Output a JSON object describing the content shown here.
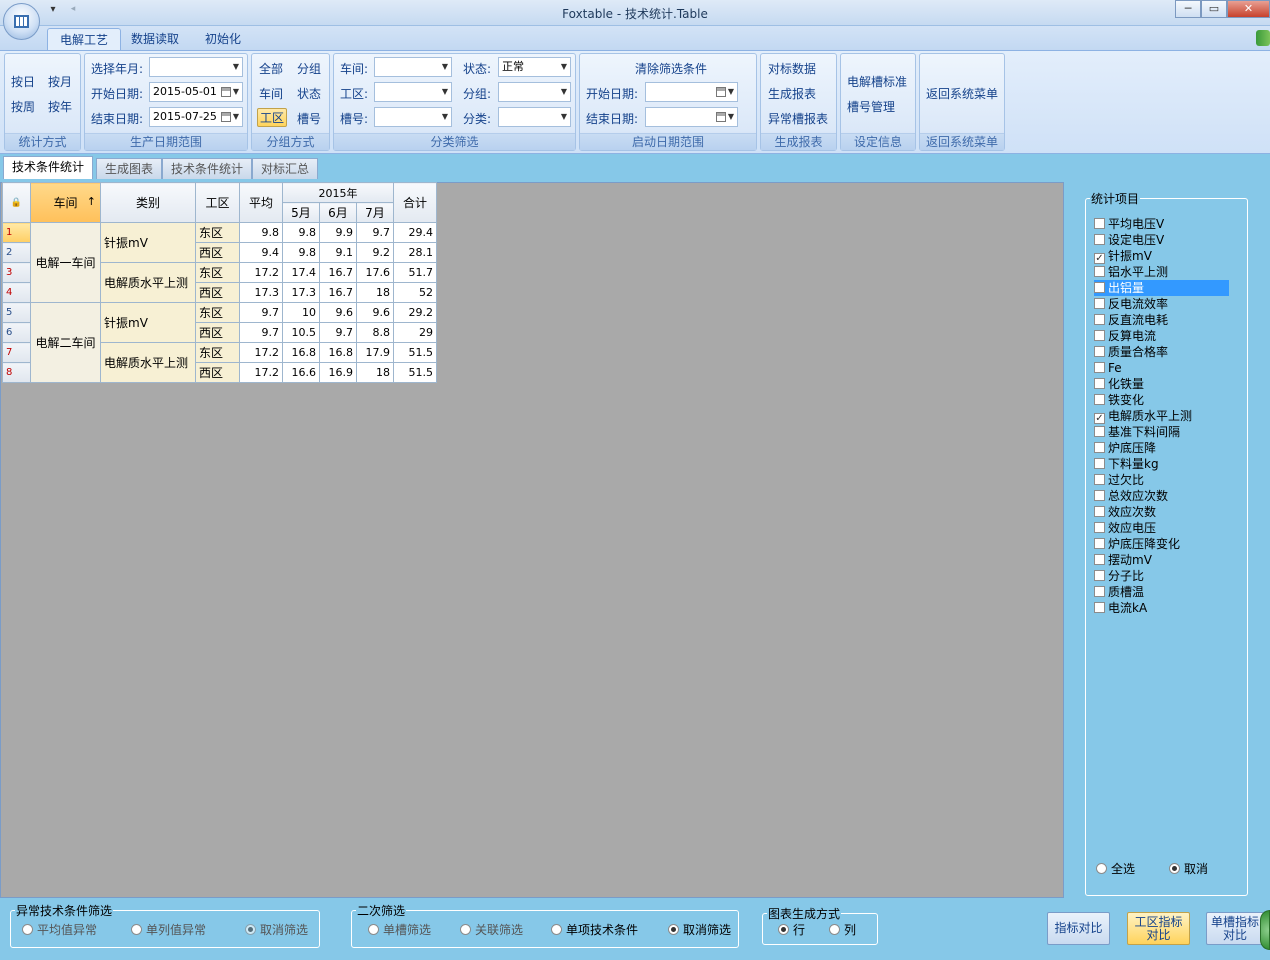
{
  "window": {
    "title": "Foxtable - 技术统计.Table"
  },
  "ribbon_tabs": [
    "电解工艺",
    "数据读取",
    "初始化"
  ],
  "groups": {
    "stat": {
      "label": "统计方式",
      "buttons": [
        "按日",
        "按月",
        "按周",
        "按年"
      ]
    },
    "range": {
      "label": "生产日期范围",
      "ym_label": "选择年月:",
      "ym_value": "",
      "start_label": "开始日期:",
      "start_value": "2015-05-01",
      "end_label": "结束日期:",
      "end_value": "2015-07-25"
    },
    "grouping": {
      "label": "分组方式",
      "buttons": [
        "全部",
        "分组",
        "车间",
        "状态",
        "工区",
        "槽号"
      ],
      "selected": "工区"
    },
    "filter": {
      "label": "分类筛选",
      "workshop_label": "车间:",
      "workshop_value": "",
      "area_label": "工区:",
      "area_value": "",
      "cell_label": "槽号:",
      "cell_value": "",
      "status_label": "状态:",
      "status_value": "正常",
      "group_label": "分组:",
      "group_value": "",
      "class_label": "分类:",
      "class_value": ""
    },
    "startdate": {
      "label": "启动日期范围",
      "clear": "清除筛选条件",
      "start_label": "开始日期:",
      "start_value": "",
      "end_label": "结束日期:",
      "end_value": ""
    },
    "report": {
      "label": "生成报表",
      "buttons": [
        "对标数据",
        "生成报表",
        "异常槽报表"
      ]
    },
    "settings": {
      "label": "设定信息",
      "buttons": [
        "电解槽标准",
        "槽号管理"
      ]
    },
    "back": {
      "label": "返回系统菜单",
      "button": "返回系统菜单"
    }
  },
  "doc_tabs": [
    "技术条件统计",
    "生成图表",
    "技术条件统计",
    "对标汇总"
  ],
  "table": {
    "headers": {
      "workshop": "车间",
      "sort_arrow": "↑",
      "category": "类别",
      "area": "工区",
      "avg": "平均",
      "year": "2015年",
      "months": [
        "5月",
        "6月",
        "7月"
      ],
      "total": "合计"
    },
    "rows": [
      {
        "idx": "1",
        "workshop": "电解一车间",
        "category": "针振mV",
        "area": "东区",
        "avg": "9.8",
        "m5": "9.8",
        "m6": "9.9",
        "m7": "9.7",
        "total": "29.4"
      },
      {
        "idx": "2",
        "area": "西区",
        "avg": "9.4",
        "m5": "9.8",
        "m6": "9.1",
        "m7": "9.2",
        "total": "28.1"
      },
      {
        "idx": "3",
        "category": "电解质水平上测",
        "area": "东区",
        "avg": "17.2",
        "m5": "17.4",
        "m6": "16.7",
        "m7": "17.6",
        "total": "51.7"
      },
      {
        "idx": "4",
        "area": "西区",
        "avg": "17.3",
        "m5": "17.3",
        "m6": "16.7",
        "m7": "18",
        "total": "52"
      },
      {
        "idx": "5",
        "workshop": "电解二车间",
        "category": "针振mV",
        "area": "东区",
        "avg": "9.7",
        "m5": "10",
        "m6": "9.6",
        "m7": "9.6",
        "total": "29.2"
      },
      {
        "idx": "6",
        "area": "西区",
        "avg": "9.7",
        "m5": "10.5",
        "m6": "9.7",
        "m7": "8.8",
        "total": "29"
      },
      {
        "idx": "7",
        "category": "电解质水平上测",
        "area": "东区",
        "avg": "17.2",
        "m5": "16.8",
        "m6": "16.8",
        "m7": "17.9",
        "total": "51.5"
      },
      {
        "idx": "8",
        "area": "西区",
        "avg": "17.2",
        "m5": "16.6",
        "m6": "16.9",
        "m7": "18",
        "total": "51.5"
      }
    ]
  },
  "stat_items": {
    "title": "统计项目",
    "items": [
      {
        "label": "平均电压V",
        "checked": false
      },
      {
        "label": "设定电压V",
        "checked": false
      },
      {
        "label": "针振mV",
        "checked": true
      },
      {
        "label": "铝水平上测",
        "checked": false
      },
      {
        "label": "出铝量",
        "checked": false,
        "highlight": true
      },
      {
        "label": "反电流效率",
        "checked": false
      },
      {
        "label": "反直流电耗",
        "checked": false
      },
      {
        "label": "反算电流",
        "checked": false
      },
      {
        "label": "质量合格率",
        "checked": false
      },
      {
        "label": "Fe",
        "checked": false
      },
      {
        "label": "化铁量",
        "checked": false
      },
      {
        "label": "铁变化",
        "checked": false
      },
      {
        "label": "电解质水平上测",
        "checked": true
      },
      {
        "label": "基准下料间隔",
        "checked": false
      },
      {
        "label": "炉底压降",
        "checked": false
      },
      {
        "label": "下料量kg",
        "checked": false
      },
      {
        "label": "过欠比",
        "checked": false
      },
      {
        "label": "总效应次数",
        "checked": false
      },
      {
        "label": "效应次数",
        "checked": false
      },
      {
        "label": "效应电压",
        "checked": false
      },
      {
        "label": "炉底压降变化",
        "checked": false
      },
      {
        "label": "摆动mV",
        "checked": false
      },
      {
        "label": "分子比",
        "checked": false
      },
      {
        "label": "质槽温",
        "checked": false
      },
      {
        "label": "电流kA",
        "checked": false
      }
    ],
    "select_all": "全选",
    "cancel": "取消"
  },
  "bottom": {
    "abnormal": {
      "title": "异常技术条件筛选",
      "opts": [
        "平均值异常",
        "单列值异常",
        "取消筛选"
      ]
    },
    "secondary": {
      "title": "二次筛选",
      "opts": [
        "单槽筛选",
        "关联筛选",
        "单项技术条件",
        "取消筛选"
      ]
    },
    "chartmode": {
      "title": "图表生成方式",
      "opts": [
        "行",
        "列"
      ]
    },
    "buttons": {
      "compare": "指标对比",
      "area_line1": "工区指标",
      "area_line2": "对比",
      "cell_line1": "单槽指标",
      "cell_line2": "对比"
    }
  }
}
